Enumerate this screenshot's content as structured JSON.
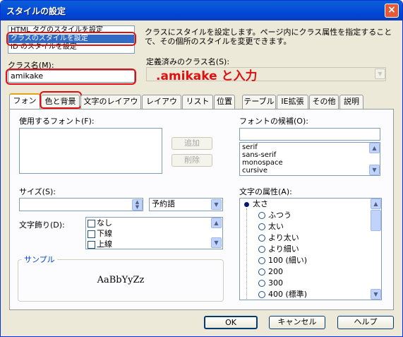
{
  "window": {
    "title": "スタイルの設定",
    "close": "×"
  },
  "style_type_list": {
    "items": [
      {
        "label": "HTML タグのスタイルを設定",
        "selected": false
      },
      {
        "label": "クラスのスタイルを設定",
        "selected": true
      },
      {
        "label": "ID のスタイルを設定",
        "selected": false
      }
    ]
  },
  "description": "クラスにスタイルを設定します。ページ内にクラス属性を指定することで、その個所のスタイルを変更できます。",
  "class_name": {
    "label": "クラス名(M):",
    "value": "amikake"
  },
  "defined_classes": {
    "label": "定義済みのクラス名(S):"
  },
  "annotation": ".amikake と入力",
  "tabs": [
    "フォント",
    "色と背景",
    "文字のレイアウト",
    "レイアウト",
    "リスト",
    "位置",
    "テーブル",
    "IE拡張",
    "その他",
    "説明"
  ],
  "font": {
    "use_label": "使用するフォント(F):",
    "candidates_label": "フォントの候補(O):",
    "add_button": "追加",
    "remove_button": "削除",
    "candidates": [
      "serif",
      "sans-serif",
      "monospace",
      "cursive"
    ]
  },
  "size": {
    "label": "サイズ(S):",
    "reserved_word": "予約語"
  },
  "decoration": {
    "label": "文字飾り(D):",
    "options": [
      "なし",
      "下線",
      "上線"
    ]
  },
  "sample": {
    "label": "サンプル",
    "text": "AaBbYyZz"
  },
  "attributes": {
    "label": "文字の属性(A):",
    "root": "太さ",
    "items": [
      "ふつう",
      "太い",
      "より太い",
      "より細い",
      "100 (細い)",
      "200",
      "300",
      "400 (標準)"
    ]
  },
  "footer": {
    "ok": "OK",
    "cancel": "キャンセル",
    "help": "ヘルプ"
  },
  "colors": {
    "accent": "#316ac5",
    "title": "#0054e3",
    "annotation": "#e01010"
  }
}
